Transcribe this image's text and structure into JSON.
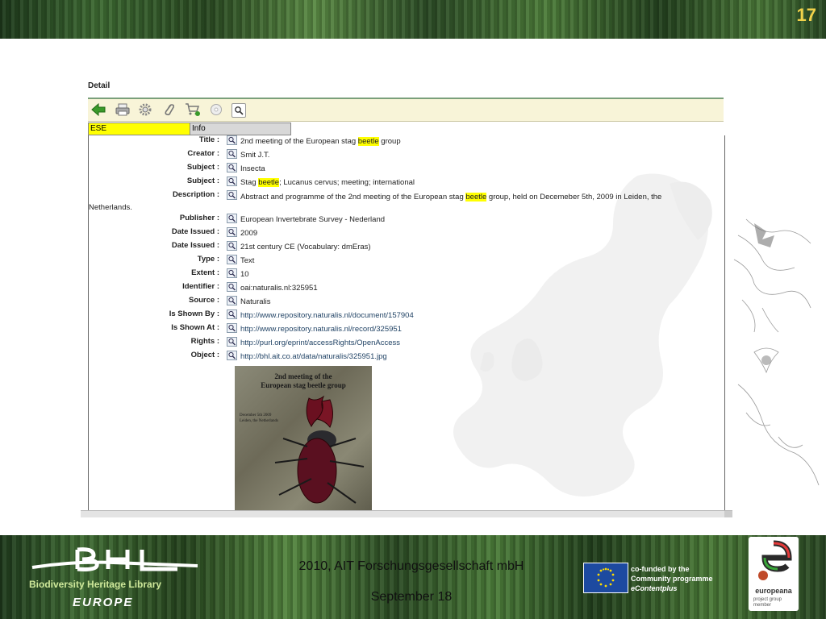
{
  "slide_number": "17",
  "panel": {
    "title": "Detail",
    "tabs": {
      "ese": "ESE",
      "info": "Info"
    }
  },
  "fields": [
    {
      "label": "Title :",
      "parts": [
        {
          "t": "2nd meeting of the European stag "
        },
        {
          "t": "beetle",
          "hl": true
        },
        {
          "t": " group"
        }
      ]
    },
    {
      "label": "Creator :",
      "parts": [
        {
          "t": "Smit J.T."
        }
      ]
    },
    {
      "label": "Subject :",
      "parts": [
        {
          "t": "Insecta"
        }
      ]
    },
    {
      "label": "Subject :",
      "parts": [
        {
          "t": "Stag "
        },
        {
          "t": "beetle",
          "hl": true
        },
        {
          "t": "; Lucanus cervus; meeting; international"
        }
      ]
    },
    {
      "label": "Description :",
      "parts": [
        {
          "t": "Abstract and programme of the 2nd meeting of the European stag "
        },
        {
          "t": "beetle",
          "hl": true
        },
        {
          "t": " group, held on Decemeber 5th, 2009 in Leiden, the Netherlands."
        }
      ]
    },
    {
      "label": "Publisher :",
      "parts": [
        {
          "t": "European Invertebrate Survey - Nederland"
        }
      ]
    },
    {
      "label": "Date Issued :",
      "parts": [
        {
          "t": "2009"
        }
      ]
    },
    {
      "label": "Date Issued :",
      "parts": [
        {
          "t": "21st century CE (Vocabulary: dmEras)"
        }
      ]
    },
    {
      "label": "Type :",
      "parts": [
        {
          "t": "Text"
        }
      ]
    },
    {
      "label": "Extent :",
      "parts": [
        {
          "t": "10"
        }
      ]
    },
    {
      "label": "Identifier :",
      "parts": [
        {
          "t": "oai:naturalis.nl:325951"
        }
      ]
    },
    {
      "label": "Source :",
      "parts": [
        {
          "t": "Naturalis"
        }
      ]
    },
    {
      "label": "Is Shown By :",
      "link": true,
      "parts": [
        {
          "t": "http://www.repository.naturalis.nl/document/157904"
        }
      ]
    },
    {
      "label": "Is Shown At :",
      "link": true,
      "parts": [
        {
          "t": "http://www.repository.naturalis.nl/record/325951"
        }
      ]
    },
    {
      "label": "Rights :",
      "link": true,
      "parts": [
        {
          "t": "http://purl.org/eprint/accessRights/OpenAccess"
        }
      ]
    },
    {
      "label": "Object :",
      "link": true,
      "parts": [
        {
          "t": "http://bhl.ait.co.at/data/naturalis/325951.jpg"
        }
      ]
    }
  ],
  "cover": {
    "title_line1": "2nd meeting of the",
    "title_line2": "European stag beetle group",
    "sub_line1": "December 5th 2009",
    "sub_line2": "Leiden, the Netherlands"
  },
  "footer": {
    "org": "2010, AIT Forschungsgesellschaft mbH",
    "date": "September 18",
    "bhl_line1": "Biodiversity Heritage Library",
    "bhl_line2": "EUROPE",
    "eu_line1": "co-funded by the",
    "eu_line2": "Community programme",
    "eu_line3": "eContentplus",
    "europeana": "europeana",
    "europeana_sub1": "project group",
    "europeana_sub2": "member"
  },
  "colors": {
    "highlight": "#ffff00",
    "slide_number": "#f2d24a",
    "toolbar_bg": "#f8f4d8"
  },
  "icons": [
    "back-arrow-icon",
    "print-icon",
    "settings-gear-icon",
    "paperclip-icon",
    "cart-add-icon",
    "disc-icon",
    "search-icon",
    "magnifier-icon"
  ]
}
